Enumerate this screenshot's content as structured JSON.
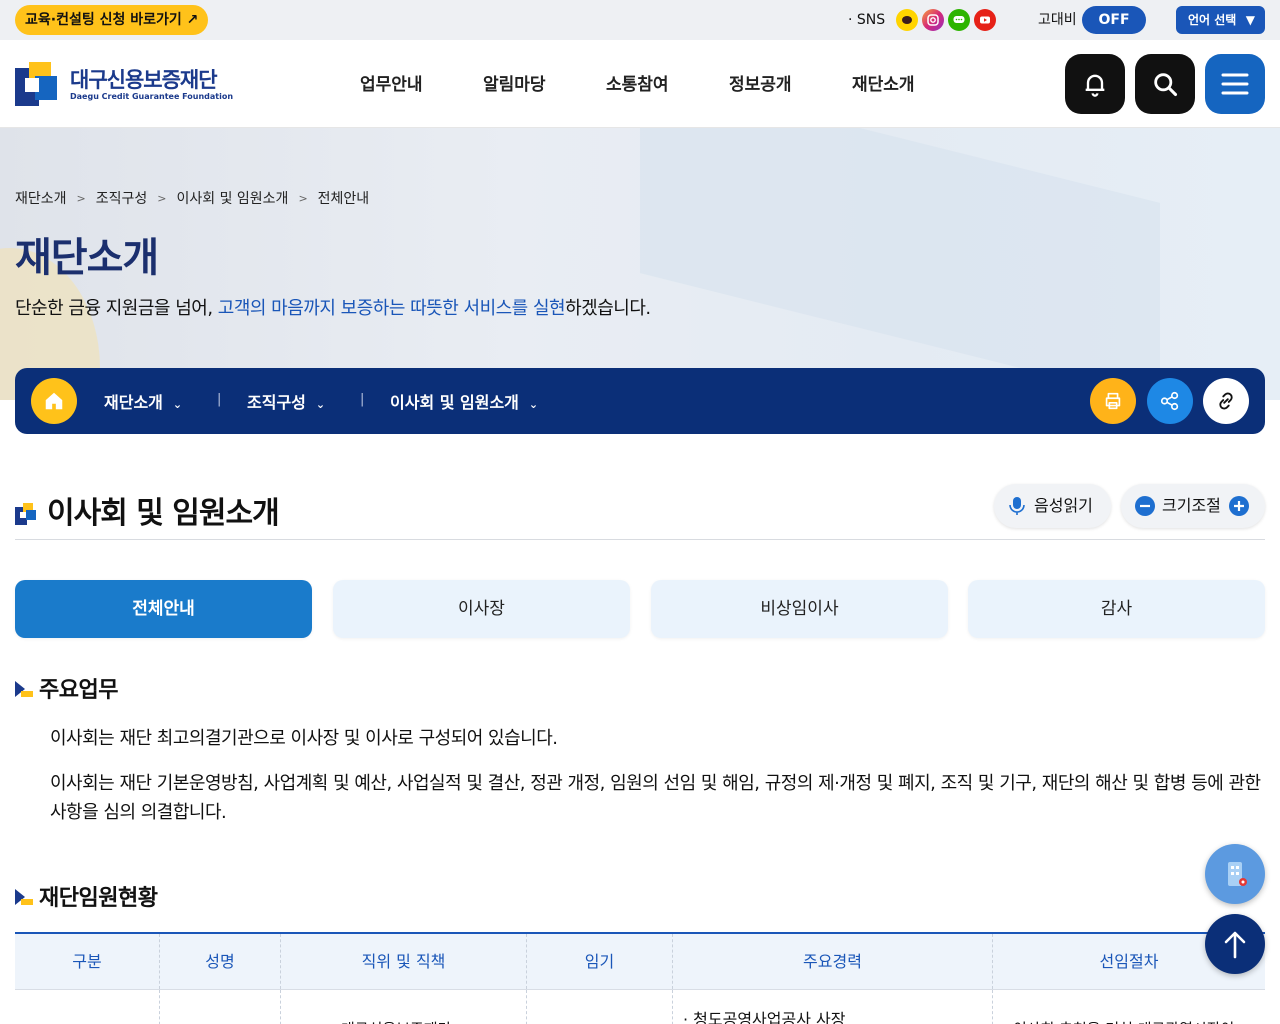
{
  "topbar": {
    "edu_link": "교육·컨설팅 신청 바로가기 ↗",
    "sns_label": "· SNS",
    "sns_icons": [
      "kakaostory-icon",
      "instagram-icon",
      "kakaotalk-icon",
      "youtube-icon"
    ],
    "contrast_label": "고대비",
    "contrast_state": "OFF",
    "language_label": "언어 선택",
    "language_arrow": "▼"
  },
  "header": {
    "logo_name": "대구신용보증재단",
    "logo_sub": "Daegu Credit Guarantee Foundation",
    "menu": [
      "업무안내",
      "알림마당",
      "소통참여",
      "정보공개",
      "재단소개"
    ]
  },
  "hero": {
    "breadcrumbs": [
      "재단소개",
      "조직구성",
      "이사회 및 임원소개",
      "전체안내"
    ],
    "breadcrumb_sep": ">",
    "title": "재단소개",
    "desc_before": "단순한 금융 지원금을 넘어, ",
    "desc_highlight": "고객의 마음까지 보증하는 따뜻한 서비스를 실현",
    "desc_after": "하겠습니다."
  },
  "subnav": {
    "items": [
      "재단소개",
      "조직구성",
      "이사회 및 임원소개"
    ],
    "divider": "|"
  },
  "section": {
    "title": "이사회 및 임원소개",
    "voice_label": "음성읽기",
    "size_label": "크기조절"
  },
  "tabs": [
    {
      "label": "전체안내",
      "active": true
    },
    {
      "label": "이사장",
      "active": false
    },
    {
      "label": "비상임이사",
      "active": false
    },
    {
      "label": "감사",
      "active": false
    }
  ],
  "content": {
    "duty_title": "주요업무",
    "duty_p1": "이사회는 재단 최고의결기관으로 이사장 및 이사로 구성되어 있습니다.",
    "duty_p2": "이사회는 재단 기본운영방침, 사업계획 및 예산, 사업실적 및 결산, 정관 개정, 임원의 선임 및 해임, 규정의 제·개정 및 폐지, 조직 및 기구, 재단의 해산 및 합병 등에 관한 사항을 심의 의결합니다.",
    "staff_title": "재단임원현황"
  },
  "table": {
    "headers": [
      "구분",
      "성명",
      "직위 및 직책",
      "임기",
      "주요경력",
      "선임절차"
    ],
    "first_row_partial": [
      "",
      "",
      "대구신용보증재단",
      "",
      "· 청도공영사업공사 사장",
      "이사회 추천을 거쳐 대구광역시장이"
    ]
  },
  "colors": {
    "brand_navy": "#0b2f78",
    "brand_blue": "#1a56b8",
    "accent_yellow": "#ffc21a",
    "tab_active": "#1a7bcb"
  }
}
